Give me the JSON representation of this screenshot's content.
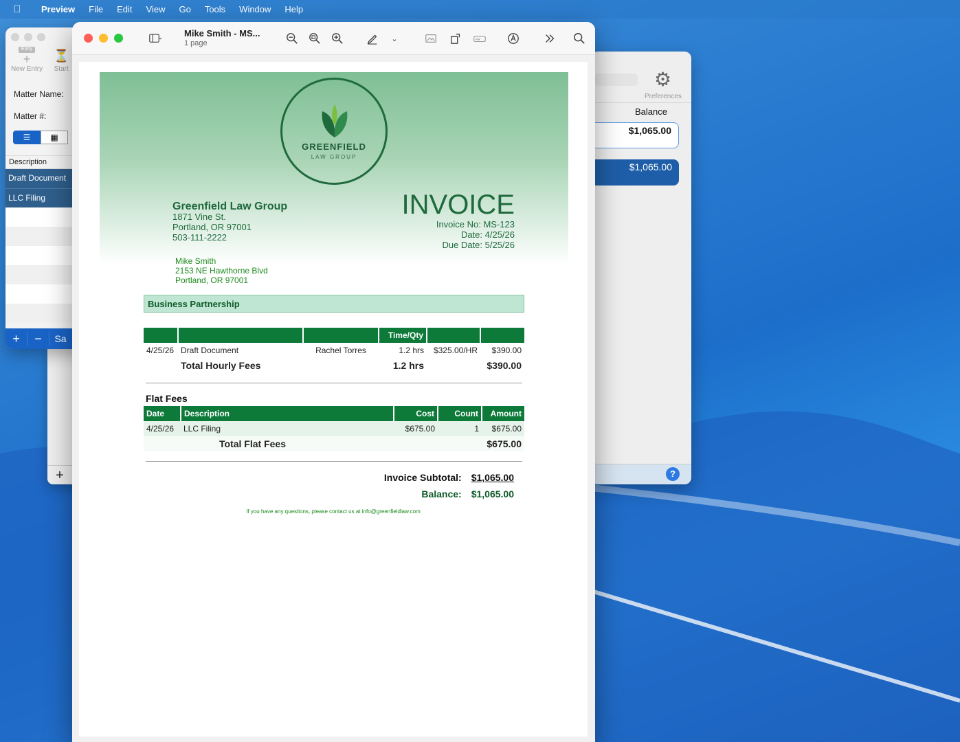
{
  "menubar": {
    "app": "Preview",
    "items": [
      "File",
      "Edit",
      "View",
      "Go",
      "Tools",
      "Window",
      "Help"
    ]
  },
  "left_window": {
    "tools": {
      "new_entry": "New Entry",
      "start": "Start",
      "entry_badge": "Entry"
    },
    "labels": {
      "matter_name": "Matter Name:",
      "matter_num": "Matter #:"
    },
    "column_header": "Description",
    "rows": [
      "Draft Document",
      "LLC Filing"
    ],
    "bottom": {
      "add": "+",
      "remove": "−",
      "save_partial": "Sa"
    }
  },
  "left_window2": {
    "add": "+"
  },
  "right_window": {
    "preferences": "Preferences",
    "balance_header": "Balance",
    "balance_1": "$1,065.00",
    "balance_2": "$1,065.00",
    "help": "?"
  },
  "preview": {
    "title": "Mike Smith - MS...",
    "subtitle": "1 page"
  },
  "invoice": {
    "logo": {
      "name": "GREENFIELD",
      "sub": "LAW GROUP"
    },
    "firm": {
      "name": "Greenfield Law Group",
      "street": "1871 Vine St.",
      "city": "Portland, OR 97001",
      "phone": "503-111-2222"
    },
    "title": "INVOICE",
    "invoice_no": "Invoice No: MS-123",
    "date": "Date: 4/25/26",
    "due": "Due Date: 5/25/26",
    "client": {
      "name": "Mike Smith",
      "street": "2153 NE Hawthorne Blvd",
      "city": "Portland, OR 97001"
    },
    "matter": "Business Partnership",
    "hourly": {
      "headers": [
        "",
        "",
        "",
        "Time/Qty",
        "",
        ""
      ],
      "row": {
        "date": "4/25/26",
        "desc": "Draft Document",
        "who": "Rachel Torres",
        "qty": "1.2 hrs",
        "rate": "$325.00/HR",
        "amount": "$390.00"
      },
      "total_label": "Total Hourly Fees",
      "total_qty": "1.2 hrs",
      "total_amount": "$390.00"
    },
    "flat": {
      "title": "Flat Fees",
      "headers": [
        "Date",
        "Description",
        "Cost",
        "Count",
        "Amount"
      ],
      "row": {
        "date": "4/25/26",
        "desc": "LLC Filing",
        "cost": "$675.00",
        "count": "1",
        "amount": "$675.00"
      },
      "total_label": "Total Flat Fees",
      "total_amount": "$675.00"
    },
    "subtotal_label": "Invoice Subtotal:",
    "subtotal": "$1,065.00",
    "balance_label": "Balance:",
    "balance": "$1,065.00",
    "footer": "If you have any questions, please contact us at info@greenfieldlaw.com"
  },
  "colors": {
    "accent_green": "#0d7a3a",
    "firm_green": "#1f6a3c",
    "client_green": "#1c8a1c",
    "mac_blue": "#1a63c6"
  }
}
